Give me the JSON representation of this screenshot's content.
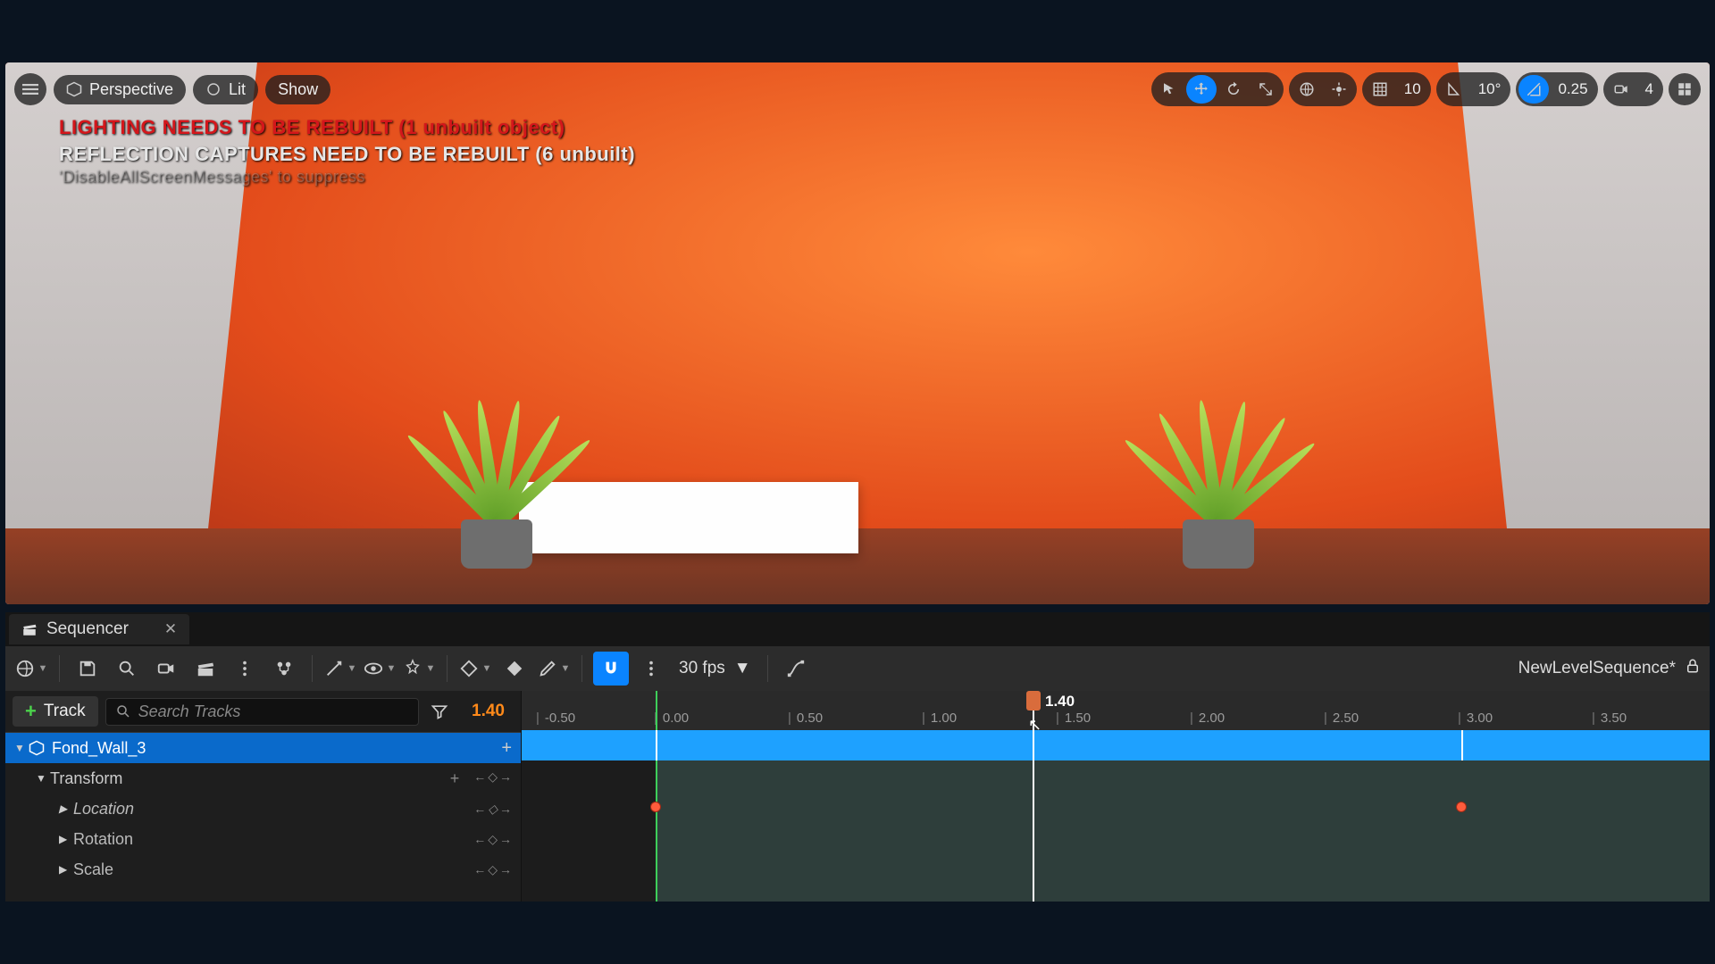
{
  "viewport": {
    "menu_button": "menu",
    "perspective": "Perspective",
    "lit": "Lit",
    "show": "Show",
    "snap_grid": "10",
    "snap_angle": "10°",
    "snap_scale": "0.25",
    "camera_speed": "4",
    "warnings": {
      "lighting": "LIGHTING NEEDS TO BE REBUILT (1 unbuilt object)",
      "reflection": "REFLECTION CAPTURES NEED TO BE REBUILT (6 unbuilt)",
      "suppress": "'DisableAllScreenMessages' to suppress"
    }
  },
  "sequencer": {
    "tab_title": "Sequencer",
    "fps_label": "30 fps",
    "sequence_name": "NewLevelSequence*",
    "track_button": "Track",
    "search_placeholder": "Search Tracks",
    "current_time": "1.40",
    "playhead_label": "1.40",
    "ruler_ticks": [
      "-0.50",
      "0.00",
      "0.50",
      "1.00",
      "1.50",
      "2.00",
      "2.50",
      "3.00",
      "3.50"
    ],
    "tracks": {
      "root": "Fond_Wall_3",
      "transform": "Transform",
      "location": "Location",
      "rotation": "Rotation",
      "scale": "Scale"
    }
  }
}
